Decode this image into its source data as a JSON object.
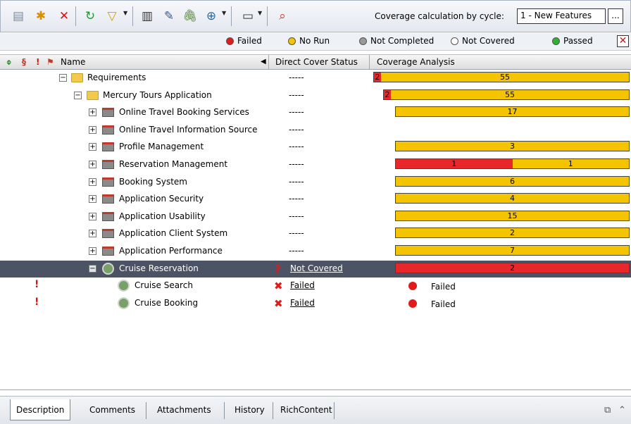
{
  "toolbar": {
    "icons": [
      "new-folder-icon",
      "new-requirement-icon",
      "delete-icon",
      "refresh-icon",
      "filter-icon",
      "columns-icon",
      "edit-icon",
      "attachment-icon",
      "zoom-icon",
      "view-icon",
      "find-icon"
    ],
    "cycle_label": "Coverage calculation by cycle:",
    "cycle_value": "1 - New Features",
    "cycle_more": "..."
  },
  "legend": {
    "items": [
      {
        "label": "Failed",
        "color": "#e01b1b"
      },
      {
        "label": "No Run",
        "color": "#f5c400"
      },
      {
        "label": "Not Completed",
        "color": "#9a9a9a"
      },
      {
        "label": "Not Covered",
        "color": "#ffffff"
      },
      {
        "label": "Passed",
        "color": "#2db32d"
      }
    ],
    "close": "✕"
  },
  "columns": {
    "name": "Name",
    "direct_cover_status": "Direct Cover Status",
    "coverage_analysis": "Coverage Analysis"
  },
  "rows": [
    {
      "name": "Requirements",
      "status": "-----",
      "coverage": {
        "failed": 2,
        "no_run": 55
      }
    },
    {
      "name": "Mercury Tours Application",
      "status": "-----",
      "coverage": {
        "failed": 2,
        "no_run": 55
      }
    },
    {
      "name": "Online Travel Booking Services",
      "status": "-----",
      "coverage": {
        "no_run": 17
      }
    },
    {
      "name": "Online Travel Information Source",
      "status": "-----"
    },
    {
      "name": "Profile Management",
      "status": "-----",
      "coverage": {
        "no_run": 3
      }
    },
    {
      "name": "Reservation Management",
      "status": "-----",
      "coverage": {
        "failed": 1,
        "no_run": 1
      }
    },
    {
      "name": "Booking System",
      "status": "-----",
      "coverage": {
        "no_run": 6
      }
    },
    {
      "name": "Application Security",
      "status": "-----",
      "coverage": {
        "no_run": 4
      }
    },
    {
      "name": "Application Usability",
      "status": "-----",
      "coverage": {
        "no_run": 15
      }
    },
    {
      "name": "Application Client System",
      "status": "-----",
      "coverage": {
        "no_run": 2
      }
    },
    {
      "name": "Application Performance",
      "status": "-----",
      "coverage": {
        "no_run": 7
      }
    },
    {
      "name": "Cruise Reservation",
      "status": "Not Covered",
      "selected": true,
      "coverage": {
        "failed": 2
      }
    },
    {
      "name": "Cruise Search",
      "status": "Failed",
      "priority": "!",
      "coverage_text": "Failed"
    },
    {
      "name": "Cruise Booking",
      "status": "Failed",
      "priority": "!",
      "coverage_text": "Failed"
    }
  ],
  "tabs": [
    {
      "label": "Description",
      "active": true
    },
    {
      "label": "Comments"
    },
    {
      "label": "Attachments"
    },
    {
      "label": "History"
    },
    {
      "label": "RichContent"
    }
  ]
}
